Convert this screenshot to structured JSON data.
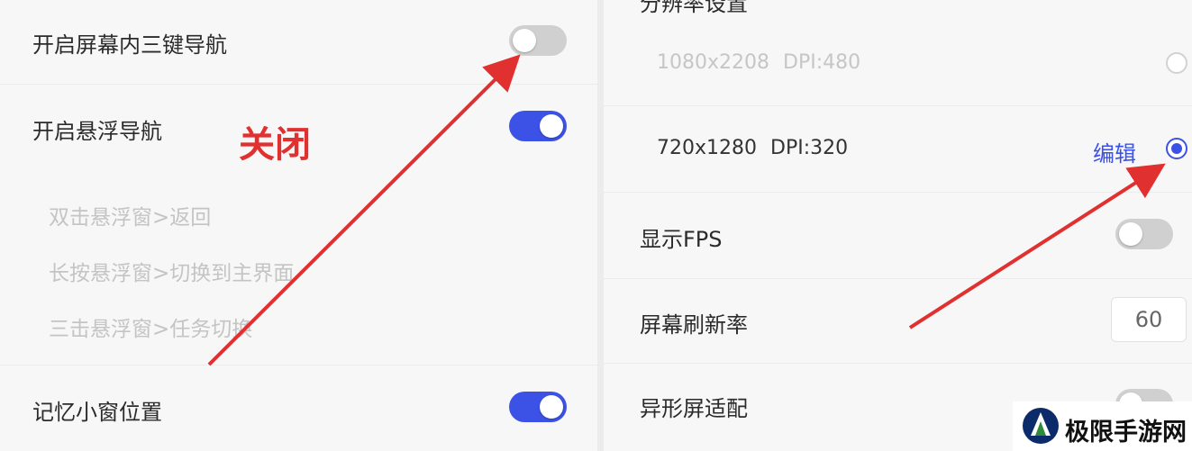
{
  "left": {
    "three_key_nav": {
      "label": "开启屏幕内三键导航",
      "state": "off"
    },
    "floating_nav": {
      "label": "开启悬浮导航",
      "state": "on"
    },
    "annotation": "关闭",
    "floating_options": [
      "双击悬浮窗>返回",
      "长按悬浮窗>切换到主界面",
      "三击悬浮窗>任务切换"
    ],
    "remember_position": {
      "label": "记忆小窗位置",
      "state": "on"
    }
  },
  "right": {
    "section_header": "分辨率设置",
    "resolutions": [
      {
        "res": "1080x2208",
        "dpi": "DPI:480",
        "selected": false
      },
      {
        "res": "720x1280",
        "dpi": "DPI:320",
        "selected": true,
        "edit_label": "编辑"
      }
    ],
    "show_fps": {
      "label": "显示FPS",
      "state": "off"
    },
    "refresh_rate": {
      "label": "屏幕刷新率",
      "value": "60"
    },
    "notch_adapt": {
      "label": "异形屏适配",
      "state": "off"
    }
  },
  "watermark": {
    "text": "极限手游网"
  },
  "colors": {
    "accent": "#3c52e6",
    "annotation": "#e03030",
    "toggle_off": "#d0d0d0"
  }
}
